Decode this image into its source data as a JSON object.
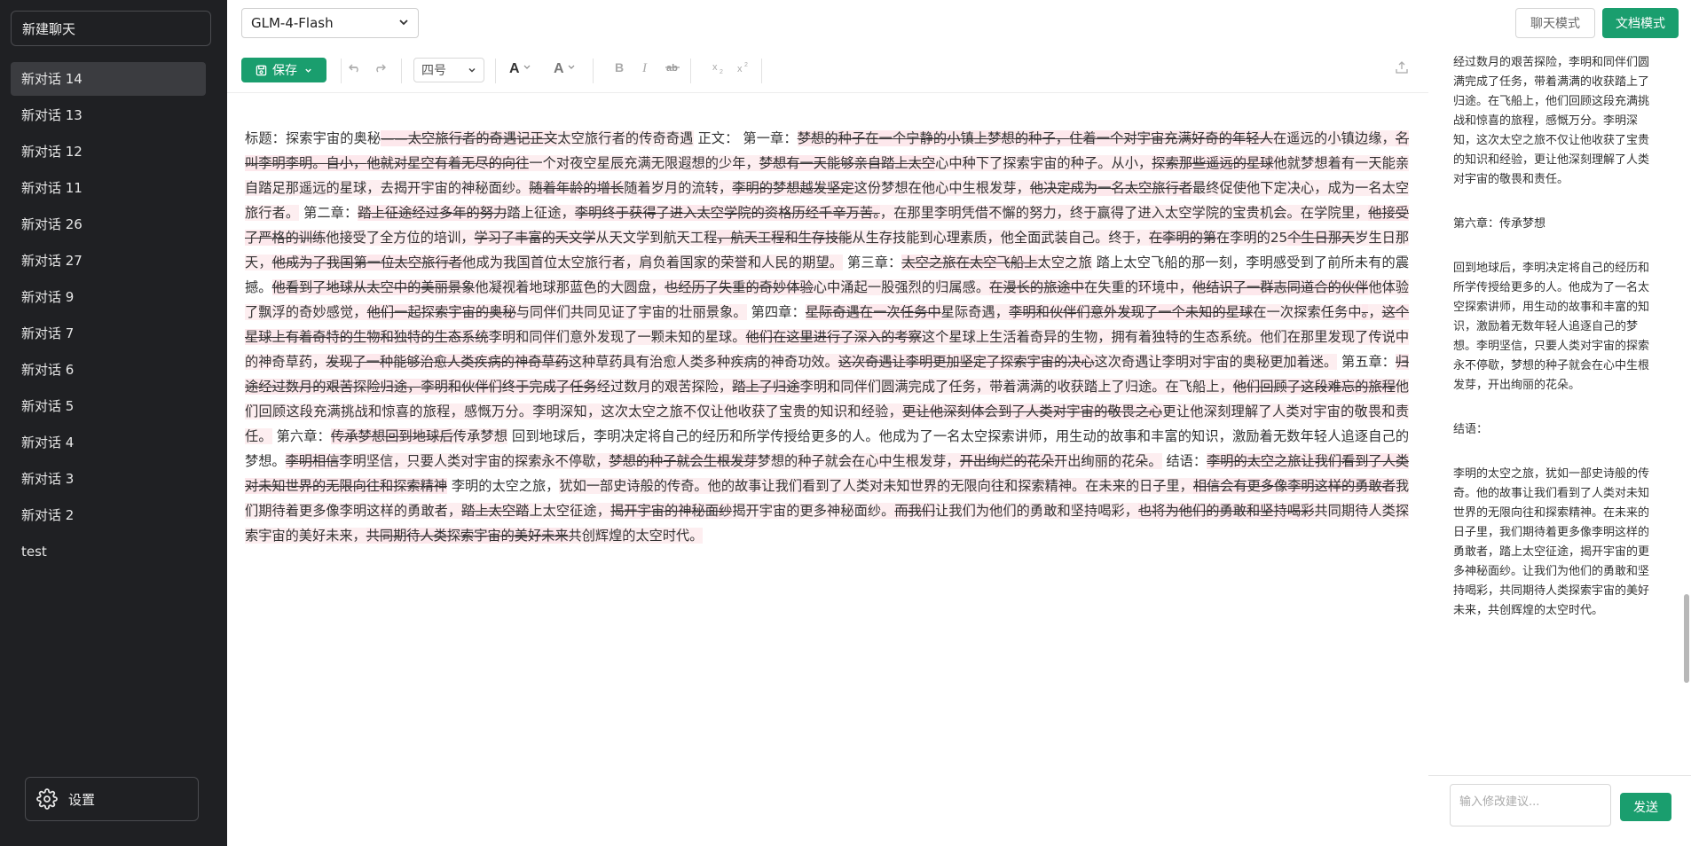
{
  "sidebar": {
    "new_chat_label": "新建聊天",
    "conversations": [
      {
        "label": "新对话 14"
      },
      {
        "label": "新对话 13"
      },
      {
        "label": "新对话 12"
      },
      {
        "label": "新对话 11"
      },
      {
        "label": "新对话 26"
      },
      {
        "label": "新对话 27"
      },
      {
        "label": "新对话 9"
      },
      {
        "label": "新对话 7"
      },
      {
        "label": "新对话 6"
      },
      {
        "label": "新对话 5"
      },
      {
        "label": "新对话 4"
      },
      {
        "label": "新对话 3"
      },
      {
        "label": "新对话 2"
      },
      {
        "label": "test"
      }
    ],
    "settings_label": "设置"
  },
  "topbar": {
    "model": "GLM-4-Flash",
    "chat_mode_label": "聊天模式",
    "doc_mode_label": "文档模式"
  },
  "toolbar": {
    "save_label": "保存",
    "font_size": "四号"
  },
  "document": {
    "segments": [
      {
        "t": "n",
        "text": "标题：探索宇宙的奥秘"
      },
      {
        "t": "d",
        "text": "——太空旅行者的奇遇记正文"
      },
      {
        "t": "i",
        "text": "太空旅行者的传奇奇遇"
      },
      {
        "t": "n",
        "text": " 正文：  第一章："
      },
      {
        "t": "d",
        "text": "梦想的种子在一个宁静的小镇上梦想的种子，"
      },
      {
        "t": "d",
        "text": "住着一个对宇宙充满好奇的年轻人"
      },
      {
        "t": "i",
        "text": "在遥远的小镇边缘，"
      },
      {
        "t": "d",
        "text": "名叫李明李明。自小，"
      },
      {
        "t": "d",
        "text": "他就对星空有着无尽的向往"
      },
      {
        "t": "i",
        "text": "一个对夜空星辰充满无限遐想的少年，"
      },
      {
        "t": "d",
        "text": "梦想有一天能够亲自踏上太空"
      },
      {
        "t": "i",
        "text": "心中种下了探索宇宙的种子。从小，"
      },
      {
        "t": "d",
        "text": "探索那些遥远的星球"
      },
      {
        "t": "i",
        "text": "他就梦想着有一天能亲自踏足那遥远的星球，去揭开宇宙的神秘面纱。"
      },
      {
        "t": "d",
        "text": "随着年龄的增长"
      },
      {
        "t": "i",
        "text": "随着岁月的流转，"
      },
      {
        "t": "d",
        "text": "李明的梦想越发坚定"
      },
      {
        "t": "i",
        "text": "这份梦想在他心中生根发芽，"
      },
      {
        "t": "d",
        "text": "他决定成为一名太空旅行者"
      },
      {
        "t": "i",
        "text": "最终促使他下定决心，成为一名太空旅行者。"
      },
      {
        "t": "n",
        "text": " 第二章："
      },
      {
        "t": "d",
        "text": "踏上征途经过多年的努力"
      },
      {
        "t": "i",
        "text": "踏上征途，"
      },
      {
        "t": "d",
        "text": "李明终于获得了进入太空学院的资格历经千辛万苦。"
      },
      {
        "t": "i",
        "text": "，在那里李明凭借不懈的努力，终于赢得了进入太空学院的宝贵机会。在学院里，"
      },
      {
        "t": "d",
        "text": "他接受了严格的训练"
      },
      {
        "t": "i",
        "text": "他接受了全方位的培训，"
      },
      {
        "t": "d",
        "text": "学习了丰富的天文学"
      },
      {
        "t": "i",
        "text": "从天文学到航天工程"
      },
      {
        "t": "d",
        "text": "，航天工程和生存技能"
      },
      {
        "t": "i",
        "text": "从生存技能到心理素质，他全面武装自己。终于，"
      },
      {
        "t": "d",
        "text": "在李明的第"
      },
      {
        "t": "i",
        "text": "在李明的25"
      },
      {
        "t": "d",
        "text": "个生日那天"
      },
      {
        "t": "i",
        "text": "岁生日那天，"
      },
      {
        "t": "d",
        "text": "他成为了我国第一位太空旅行者"
      },
      {
        "t": "i",
        "text": "他成为我国首位太空旅行者，肩负着国家的荣誉和人民的期望。"
      },
      {
        "t": "n",
        "text": " 第三章："
      },
      {
        "t": "d",
        "text": "太空之旅在太空飞船上"
      },
      {
        "t": "i",
        "text": "太空之旅"
      },
      {
        "t": "n",
        "text": " 踏上太空飞船的那一刻，李明感受到了前所未有的震撼。"
      },
      {
        "t": "d",
        "text": "他看到了地球从太空中的美丽景象"
      },
      {
        "t": "i",
        "text": "他凝视着地球那蓝色的大圆盘，"
      },
      {
        "t": "d",
        "text": "也经历了失重的奇妙体验"
      },
      {
        "t": "i",
        "text": "心中涌起一股强烈的归属感。"
      },
      {
        "t": "d",
        "text": "在漫长的旅途中"
      },
      {
        "t": "i",
        "text": "在失重的环境中，"
      },
      {
        "t": "d",
        "text": "他结识了一群志同道合的伙伴"
      },
      {
        "t": "i",
        "text": "他体验了飘浮的奇妙感觉，"
      },
      {
        "t": "d",
        "text": "他们一起探索宇宙的奥秘"
      },
      {
        "t": "i",
        "text": "与同伴们共同见证了宇宙的壮丽景象。"
      },
      {
        "t": "n",
        "text": " 第四章："
      },
      {
        "t": "d",
        "text": "星际奇遇在一次任务中"
      },
      {
        "t": "i",
        "text": "星际奇遇，"
      },
      {
        "t": "d",
        "text": "李明和伙伴们意外发现了一个未知的星球"
      },
      {
        "t": "i",
        "text": "在一次探索任务中"
      },
      {
        "t": "d",
        "text": "。"
      },
      {
        "t": "i",
        "text": "，"
      },
      {
        "t": "d",
        "text": "这个星球上有着奇特的生物和独特的生态系统"
      },
      {
        "t": "i",
        "text": "李明和同伴们意外发现了一颗未知的星球。"
      },
      {
        "t": "d",
        "text": "他们在这里进行了深入的考察"
      },
      {
        "t": "i",
        "text": "这个星球上生活着奇异的生物，拥有着独特的生态系统。他们在那里发现了传说中的神奇草药，"
      },
      {
        "t": "d",
        "text": "发现了一种能够治愈人类疾病的神奇草药"
      },
      {
        "t": "i",
        "text": "这种草药具有治愈人类多种疾病的神奇功效。"
      },
      {
        "t": "d",
        "text": "这次奇遇让李明更加坚定了探索宇宙的决心"
      },
      {
        "t": "i",
        "text": "这次奇遇让李明对宇宙的奥秘更加着迷。"
      },
      {
        "t": "n",
        "text": " 第五章："
      },
      {
        "t": "d",
        "text": "归途经过数月的艰苦探险归途，"
      },
      {
        "t": "d",
        "text": "李明和伙伴们终于完成了任务"
      },
      {
        "t": "i",
        "text": "经过数月的艰苦探险，"
      },
      {
        "t": "d",
        "text": "踏上了归途"
      },
      {
        "t": "i",
        "text": "李明和同伴们圆满完成了任务，带着满满的收获踏上了归途。在飞船上，"
      },
      {
        "t": "d",
        "text": "他们回顾了这段难忘的旅程"
      },
      {
        "t": "i",
        "text": "他们回顾这段充满挑战和惊喜的旅程，感慨万分。李明深知，这次太空之旅不仅让他收获了宝贵的知识和经验，"
      },
      {
        "t": "d",
        "text": "更让他深刻体会到了人类对宇宙的敬畏之心"
      },
      {
        "t": "i",
        "text": "更让他深刻理解了人类对宇宙的敬畏和责任。"
      },
      {
        "t": "n",
        "text": " 第六章："
      },
      {
        "t": "d",
        "text": "传承梦想回到地球后"
      },
      {
        "t": "i",
        "text": "传承梦想"
      },
      {
        "t": "n",
        "text": " 回到地球后，李明决定将自己的经历和所学传授给更多的人。他成为了一名太空探索讲师，用生动的故事和丰富的知识，激励着无数年轻人追逐自己的梦想。"
      },
      {
        "t": "d",
        "text": "李明相信"
      },
      {
        "t": "i",
        "text": "李明坚信，只要人类对宇宙的探索永不停歇，"
      },
      {
        "t": "d",
        "text": "梦想的种子就会生根发芽"
      },
      {
        "t": "i",
        "text": "梦想的种子就会在心中生根发芽，"
      },
      {
        "t": "d",
        "text": "开出绚烂的花朵"
      },
      {
        "t": "i",
        "text": "开出绚丽的花朵。"
      },
      {
        "t": "n",
        "text": " 结语："
      },
      {
        "t": "d",
        "text": "李明的太空之旅让我们看到了人类对未知世界的无限向往和探索精神"
      },
      {
        "t": "n",
        "text": " 李明的太空之旅，"
      },
      {
        "t": "i",
        "text": "犹如一部史诗般的传奇。他的故事让我们看到了人类对未知世界的无限向往和探索精神。在未来的日子里，"
      },
      {
        "t": "d",
        "text": "相信会有更多像李明这样的勇敢者"
      },
      {
        "t": "i",
        "text": "我们期待着更多像李明这样的勇敢者，"
      },
      {
        "t": "d",
        "text": "踏上太空踏"
      },
      {
        "t": "i",
        "text": "上太空征途，"
      },
      {
        "t": "d",
        "text": "揭开宇宙的神秘面纱"
      },
      {
        "t": "i",
        "text": "揭开宇宙的更多神秘面纱。"
      },
      {
        "t": "d",
        "text": "而我们"
      },
      {
        "t": "i",
        "text": "让我们为他们的勇敢和坚持喝彩，"
      },
      {
        "t": "d",
        "text": "也将为他们的勇敢和坚持喝彩"
      },
      {
        "t": "i",
        "text": "共同期待人类探索宇宙的美好未来，"
      },
      {
        "t": "d",
        "text": "共同期待人类探索宇宙的美好未来"
      },
      {
        "t": "i",
        "text": "共创辉煌的太空时代。"
      }
    ]
  },
  "panel": {
    "paragraphs": [
      "经过数月的艰苦探险，李明和同伴们圆满完成了任务，带着满满的收获踏上了归途。在飞船上，他们回顾这段充满挑战和惊喜的旅程，感慨万分。李明深知，这次太空之旅不仅让他收获了宝贵的知识和经验，更让他深刻理解了人类对宇宙的敬畏和责任。",
      "第六章：传承梦想",
      "回到地球后，李明决定将自己的经历和所学传授给更多的人。他成为了一名太空探索讲师，用生动的故事和丰富的知识，激励着无数年轻人追逐自己的梦想。李明坚信，只要人类对宇宙的探索永不停歇，梦想的种子就会在心中生根发芽，开出绚丽的花朵。",
      "结语：",
      "李明的太空之旅，犹如一部史诗般的传奇。他的故事让我们看到了人类对未知世界的无限向往和探索精神。在未来的日子里，我们期待着更多像李明这样的勇敢者，踏上太空征途，揭开宇宙的更多神秘面纱。让我们为他们的勇敢和坚持喝彩，共同期待人类探索宇宙的美好未来，共创辉煌的太空时代。"
    ],
    "input_placeholder": "输入修改建议...",
    "send_label": "发送"
  },
  "colors": {
    "accent": "#1a9e6e",
    "sidebar_bg": "#1f2023",
    "deletion_highlight": "#fde8ec"
  }
}
